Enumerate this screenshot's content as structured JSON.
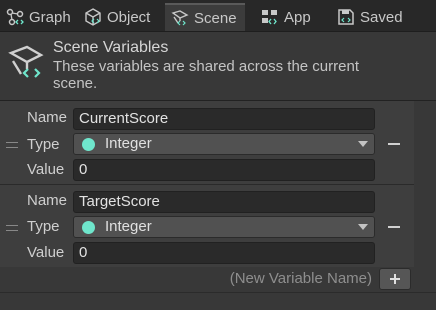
{
  "tabs": [
    {
      "label": "Graph",
      "icon": "graph-icon"
    },
    {
      "label": "Object",
      "icon": "cube-icon"
    },
    {
      "label": "Scene",
      "icon": "scene-icon",
      "active": true
    },
    {
      "label": "App",
      "icon": "app-icon"
    },
    {
      "label": "Saved",
      "icon": "save-icon"
    }
  ],
  "header": {
    "title": "Scene Variables",
    "description": "These variables are shared across the current scene.",
    "icon": "scene-variables-icon"
  },
  "field_labels": {
    "name": "Name",
    "type": "Type",
    "value": "Value"
  },
  "variables": [
    {
      "name": "CurrentScore",
      "type": "Integer",
      "value": "0"
    },
    {
      "name": "TargetScore",
      "type": "Integer",
      "value": "0"
    }
  ],
  "footer": {
    "new_variable_placeholder": "(New Variable Name)"
  },
  "colors": {
    "background": "#383838",
    "tab_bar": "#282828",
    "type_dot": "#6fe6cc",
    "field_bg": "#2a2a2a"
  }
}
